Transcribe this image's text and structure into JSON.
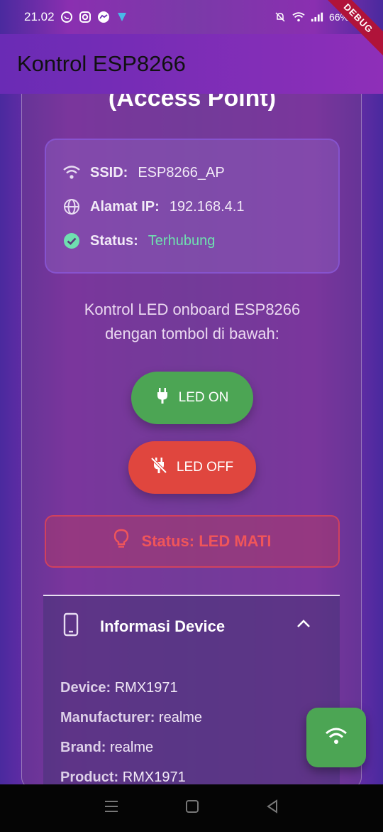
{
  "statusbar": {
    "time": "21.02",
    "battery": "66%",
    "left_icons": [
      "whatsapp-icon",
      "instagram-icon",
      "messenger-icon",
      "app-icon"
    ],
    "right_icons": [
      "mute-icon",
      "wifi-icon",
      "signal-icon",
      "battery-icon"
    ]
  },
  "appbar": {
    "title": "Kontrol ESP8266"
  },
  "debug_banner": "DEBUG",
  "card": {
    "title": "(Access Point)",
    "info": [
      {
        "icon": "wifi-icon",
        "label": "SSID:",
        "value": "ESP8266_AP"
      },
      {
        "icon": "globe-icon",
        "label": "Alamat IP:",
        "value": "192.168.4.1"
      },
      {
        "icon": "check-circle-icon",
        "label": "Status:",
        "value": "Terhubung"
      }
    ],
    "description_line1": "Kontrol LED onboard ESP8266",
    "description_line2": "dengan tombol di bawah:",
    "btn_on": "LED ON",
    "btn_off": "LED OFF",
    "led_status": "Status: LED MATI"
  },
  "device_panel": {
    "title": "Informasi Device",
    "rows": [
      {
        "label": "Device:",
        "value": "RMX1971"
      },
      {
        "label": "Manufacturer:",
        "value": "realme"
      },
      {
        "label": "Brand:",
        "value": "realme"
      },
      {
        "label": "Product:",
        "value": "RMX1971"
      }
    ]
  },
  "colors": {
    "accent_green": "#4ca554",
    "accent_red": "#e0463e",
    "status_ok": "#6fe0b0"
  }
}
